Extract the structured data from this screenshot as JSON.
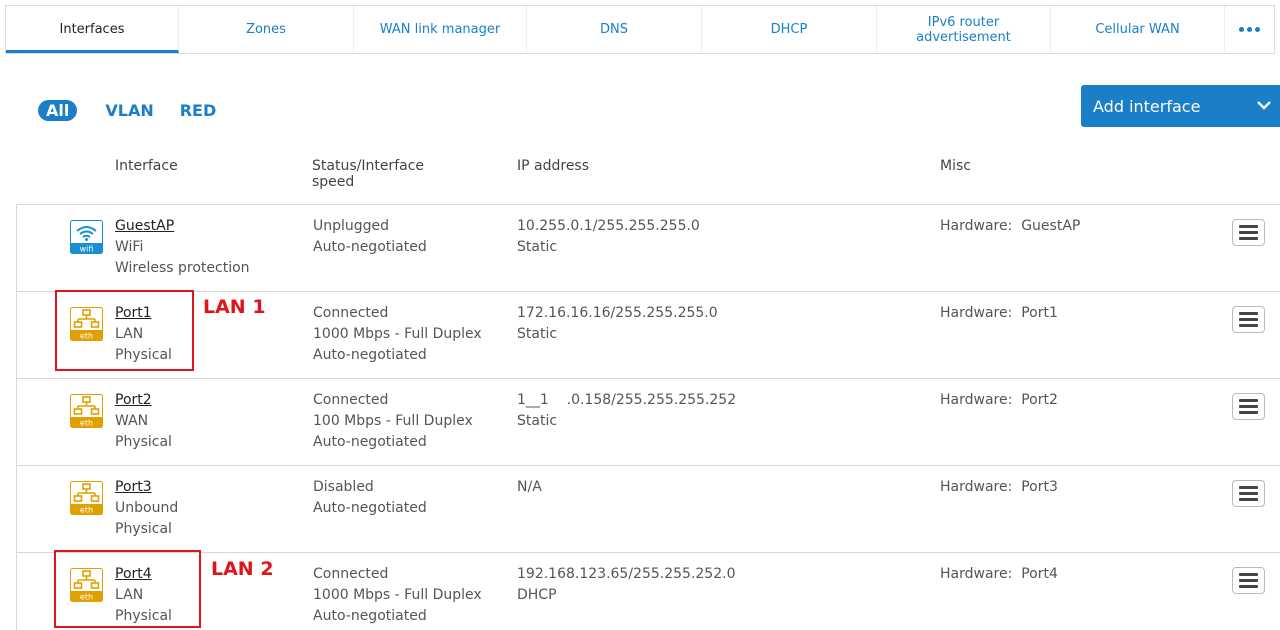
{
  "tabs": [
    {
      "label": "Interfaces",
      "active": true
    },
    {
      "label": "Zones"
    },
    {
      "label": "WAN link manager"
    },
    {
      "label": "DNS"
    },
    {
      "label": "DHCP"
    },
    {
      "label": "IPv6 router advertisement"
    },
    {
      "label": "Cellular WAN"
    }
  ],
  "more_tabs_icon": "more-dots-icon",
  "filters": {
    "all": "All",
    "vlan": "VLAN",
    "red": "RED"
  },
  "add_button": {
    "label": "Add interface"
  },
  "columns": {
    "interface": "Interface",
    "status": "Status/Interface speed",
    "ip": "IP address",
    "misc": "Misc"
  },
  "rows": [
    {
      "icon": "wifi",
      "icon_label": "wifi",
      "name": "GuestAP",
      "zone": "WiFi",
      "type": "Wireless protection",
      "status": "Unplugged",
      "speed": "Auto-negotiated",
      "speed2": "",
      "ip": "10.255.0.1/255.255.255.0",
      "ip_mode": "Static",
      "misc": "Hardware:  GuestAP"
    },
    {
      "icon": "eth",
      "icon_label": "eth",
      "name": "Port1",
      "zone": "LAN",
      "type": "Physical",
      "status": "Connected",
      "speed": "1000 Mbps - Full Duplex",
      "speed2": "Auto-negotiated",
      "ip": "172.16.16.16/255.255.255.0",
      "ip_mode": "Static",
      "misc": "Hardware:  Port1"
    },
    {
      "icon": "eth",
      "icon_label": "eth",
      "name": "Port2",
      "zone": "WAN",
      "type": "Physical",
      "status": "Connected",
      "speed": "100 Mbps - Full Duplex",
      "speed2": "Auto-negotiated",
      "ip": "1__1    .0.158/255.255.255.252",
      "ip_mode": "Static",
      "misc": "Hardware:  Port2"
    },
    {
      "icon": "eth",
      "icon_label": "eth",
      "name": "Port3",
      "zone": "Unbound",
      "type": "Physical",
      "status": "Disabled",
      "speed": "Auto-negotiated",
      "speed2": "",
      "ip": "N/A",
      "ip_mode": "",
      "misc": "Hardware:  Port3"
    },
    {
      "icon": "eth",
      "icon_label": "eth",
      "name": "Port4",
      "zone": "LAN",
      "type": "Physical",
      "status": "Connected",
      "speed": "1000 Mbps - Full Duplex",
      "speed2": "Auto-negotiated",
      "ip": "192.168.123.65/255.255.252.0",
      "ip_mode": "DHCP",
      "misc": "Hardware:  Port4"
    }
  ],
  "annotations": {
    "lan1": "LAN 1",
    "lan2": "LAN 2"
  },
  "colors": {
    "accent": "#1a7ec9",
    "eth_icon": "#e0a000",
    "highlight": "#e0151b"
  }
}
